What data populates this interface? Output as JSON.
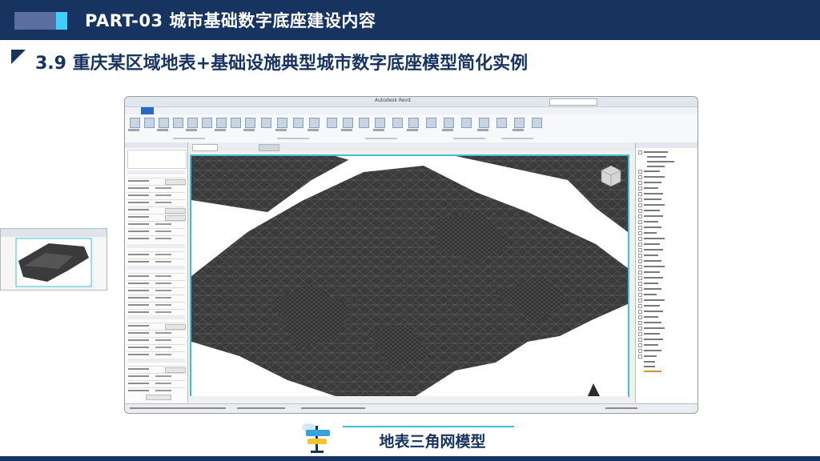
{
  "header": {
    "title": "PART-03  城市基础数字底座建设内容",
    "bar_color": "#17335f",
    "accent_color": "#3dd0ff"
  },
  "subtitle": "3.9 重庆某区域地表+基础设施典型城市数字底座模型简化实例",
  "screenshot": {
    "app": "Revit",
    "content": "terrain-triangle-mesh-3d-view",
    "viewport_border_color": "#3cc0d8",
    "mesh_color": "#3a3a3a"
  },
  "caption": "地表三角网模型"
}
